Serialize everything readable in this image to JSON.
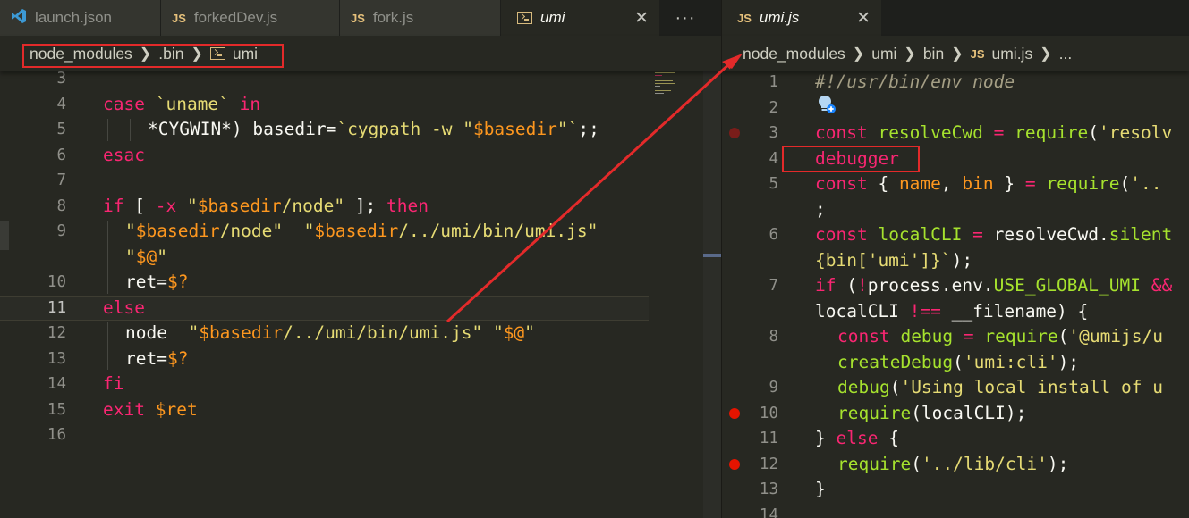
{
  "left_tabs": [
    {
      "label": "launch.json",
      "icon": "vscode-icon"
    },
    {
      "label": "forkedDev.js",
      "icon": "JS"
    },
    {
      "label": "fork.js",
      "icon": "JS"
    },
    {
      "label": "umi",
      "icon": "terminal-icon",
      "close": "✕"
    }
  ],
  "more_label": "···",
  "right_tab": {
    "label": "umi.js",
    "icon": "JS",
    "close": "✕"
  },
  "left_breadcrumb": [
    "node_modules",
    ".bin",
    "umi"
  ],
  "right_breadcrumb": [
    "node_modules",
    "umi",
    "bin",
    "JS",
    "umi.js",
    "..."
  ],
  "left_lines": [
    {
      "n": "3",
      "tokens": []
    },
    {
      "n": "4",
      "tokens": [
        [
          "kw",
          "case"
        ],
        [
          "plain",
          " "
        ],
        [
          "str",
          "`uname`"
        ],
        [
          "plain",
          " "
        ],
        [
          "kw",
          "in"
        ]
      ]
    },
    {
      "n": "5",
      "tokens": [
        [
          "plain",
          "*CYGWIN*) basedir="
        ],
        [
          "str",
          "`cygpath -w \""
        ],
        [
          "var",
          "$basedir"
        ],
        [
          "str",
          "\"`"
        ],
        [
          "plain",
          ";;"
        ]
      ]
    },
    {
      "n": "6",
      "tokens": [
        [
          "kw",
          "esac"
        ]
      ]
    },
    {
      "n": "7",
      "tokens": []
    },
    {
      "n": "8",
      "tokens": [
        [
          "kw",
          "if"
        ],
        [
          "plain",
          " [ "
        ],
        [
          "kw",
          "-x"
        ],
        [
          "plain",
          " "
        ],
        [
          "str",
          "\""
        ],
        [
          "var",
          "$basedir"
        ],
        [
          "str",
          "/node\""
        ],
        [
          "plain",
          " ]; "
        ],
        [
          "kw",
          "then"
        ]
      ]
    },
    {
      "n": "9",
      "tokens": [
        [
          "str",
          "\""
        ],
        [
          "var",
          "$basedir"
        ],
        [
          "str",
          "/node\""
        ],
        [
          "plain",
          "  "
        ],
        [
          "str",
          "\""
        ],
        [
          "var",
          "$basedir"
        ],
        [
          "str",
          "/../umi/bin/umi.js\""
        ]
      ]
    },
    {
      "n": "",
      "tokens": [
        [
          "str",
          "\""
        ],
        [
          "var",
          "$@"
        ],
        [
          "str",
          "\""
        ]
      ]
    },
    {
      "n": "10",
      "tokens": [
        [
          "plain",
          "ret="
        ],
        [
          "var",
          "$?"
        ]
      ]
    },
    {
      "n": "11",
      "tokens": [
        [
          "kw",
          "else"
        ]
      ]
    },
    {
      "n": "12",
      "tokens": [
        [
          "plain",
          "node  "
        ],
        [
          "str",
          "\""
        ],
        [
          "var",
          "$basedir"
        ],
        [
          "str",
          "/../umi/bin/umi.js\""
        ],
        [
          "plain",
          " "
        ],
        [
          "str",
          "\""
        ],
        [
          "var",
          "$@"
        ],
        [
          "str",
          "\""
        ]
      ]
    },
    {
      "n": "13",
      "tokens": [
        [
          "plain",
          "ret="
        ],
        [
          "var",
          "$?"
        ]
      ]
    },
    {
      "n": "14",
      "tokens": [
        [
          "kw",
          "fi"
        ]
      ]
    },
    {
      "n": "15",
      "tokens": [
        [
          "kw",
          "exit"
        ],
        [
          "plain",
          " "
        ],
        [
          "var",
          "$ret"
        ]
      ]
    },
    {
      "n": "16",
      "tokens": []
    }
  ],
  "right_lines": [
    {
      "n": "1",
      "tokens": [
        [
          "cmt",
          "#!/usr/bin/env node"
        ]
      ]
    },
    {
      "n": "2",
      "tokens": []
    },
    {
      "n": "3",
      "tokens": [
        [
          "kw",
          "const"
        ],
        [
          "plain",
          " "
        ],
        [
          "fn",
          "resolveCwd"
        ],
        [
          "plain",
          " "
        ],
        [
          "kw",
          "="
        ],
        [
          "plain",
          " "
        ],
        [
          "fn",
          "require"
        ],
        [
          "plain",
          "("
        ],
        [
          "str",
          "'resolv"
        ]
      ]
    },
    {
      "n": "4",
      "tokens": [
        [
          "kw",
          "debugger"
        ]
      ]
    },
    {
      "n": "5",
      "tokens": [
        [
          "kw",
          "const"
        ],
        [
          "plain",
          " { "
        ],
        [
          "var",
          "name"
        ],
        [
          "plain",
          ", "
        ],
        [
          "var",
          "bin"
        ],
        [
          "plain",
          " } "
        ],
        [
          "kw",
          "="
        ],
        [
          "plain",
          " "
        ],
        [
          "fn",
          "require"
        ],
        [
          "plain",
          "("
        ],
        [
          "str",
          "'.."
        ]
      ]
    },
    {
      "n": "",
      "tokens": [
        [
          "plain",
          ";"
        ]
      ]
    },
    {
      "n": "6",
      "tokens": [
        [
          "kw",
          "const"
        ],
        [
          "plain",
          " "
        ],
        [
          "fn",
          "localCLI"
        ],
        [
          "plain",
          " "
        ],
        [
          "kw",
          "="
        ],
        [
          "plain",
          " resolveCwd."
        ],
        [
          "fn",
          "silent"
        ]
      ]
    },
    {
      "n": "",
      "tokens": [
        [
          "str",
          "{bin['umi']}`"
        ],
        [
          "plain",
          ");"
        ]
      ]
    },
    {
      "n": "7",
      "tokens": [
        [
          "kw",
          "if"
        ],
        [
          "plain",
          " ("
        ],
        [
          "kw",
          "!"
        ],
        [
          "plain",
          "process.env."
        ],
        [
          "fn",
          "USE_GLOBAL_UMI"
        ],
        [
          "plain",
          " "
        ],
        [
          "kw",
          "&&"
        ]
      ]
    },
    {
      "n": "",
      "tokens": [
        [
          "plain",
          "localCLI "
        ],
        [
          "kw",
          "!=="
        ],
        [
          "plain",
          " __filename) {"
        ]
      ]
    },
    {
      "n": "8",
      "tokens": [
        [
          "kw",
          "const"
        ],
        [
          "plain",
          " "
        ],
        [
          "fn",
          "debug"
        ],
        [
          "plain",
          " "
        ],
        [
          "kw",
          "="
        ],
        [
          "plain",
          " "
        ],
        [
          "fn",
          "require"
        ],
        [
          "plain",
          "("
        ],
        [
          "str",
          "'@umijs/u"
        ]
      ]
    },
    {
      "n": "",
      "tokens": [
        [
          "fn",
          "createDebug"
        ],
        [
          "plain",
          "("
        ],
        [
          "str",
          "'umi:cli'"
        ],
        [
          "plain",
          ");"
        ]
      ]
    },
    {
      "n": "9",
      "tokens": [
        [
          "fn",
          "debug"
        ],
        [
          "plain",
          "("
        ],
        [
          "str",
          "'Using local install of u"
        ]
      ]
    },
    {
      "n": "10",
      "tokens": [
        [
          "fn",
          "require"
        ],
        [
          "plain",
          "(localCLI);"
        ]
      ]
    },
    {
      "n": "11",
      "tokens": [
        [
          "plain",
          "} "
        ],
        [
          "kw",
          "else"
        ],
        [
          "plain",
          " {"
        ]
      ]
    },
    {
      "n": "12",
      "tokens": [
        [
          "fn",
          "require"
        ],
        [
          "plain",
          "("
        ],
        [
          "str",
          "'../lib/cli'"
        ],
        [
          "plain",
          ");"
        ]
      ]
    },
    {
      "n": "13",
      "tokens": [
        [
          "plain",
          "}"
        ]
      ]
    },
    {
      "n": "14",
      "tokens": []
    }
  ],
  "colors": {
    "accent_red": "#e32a2a",
    "breakpoint": "#e51400",
    "editor_bg": "#272822"
  }
}
